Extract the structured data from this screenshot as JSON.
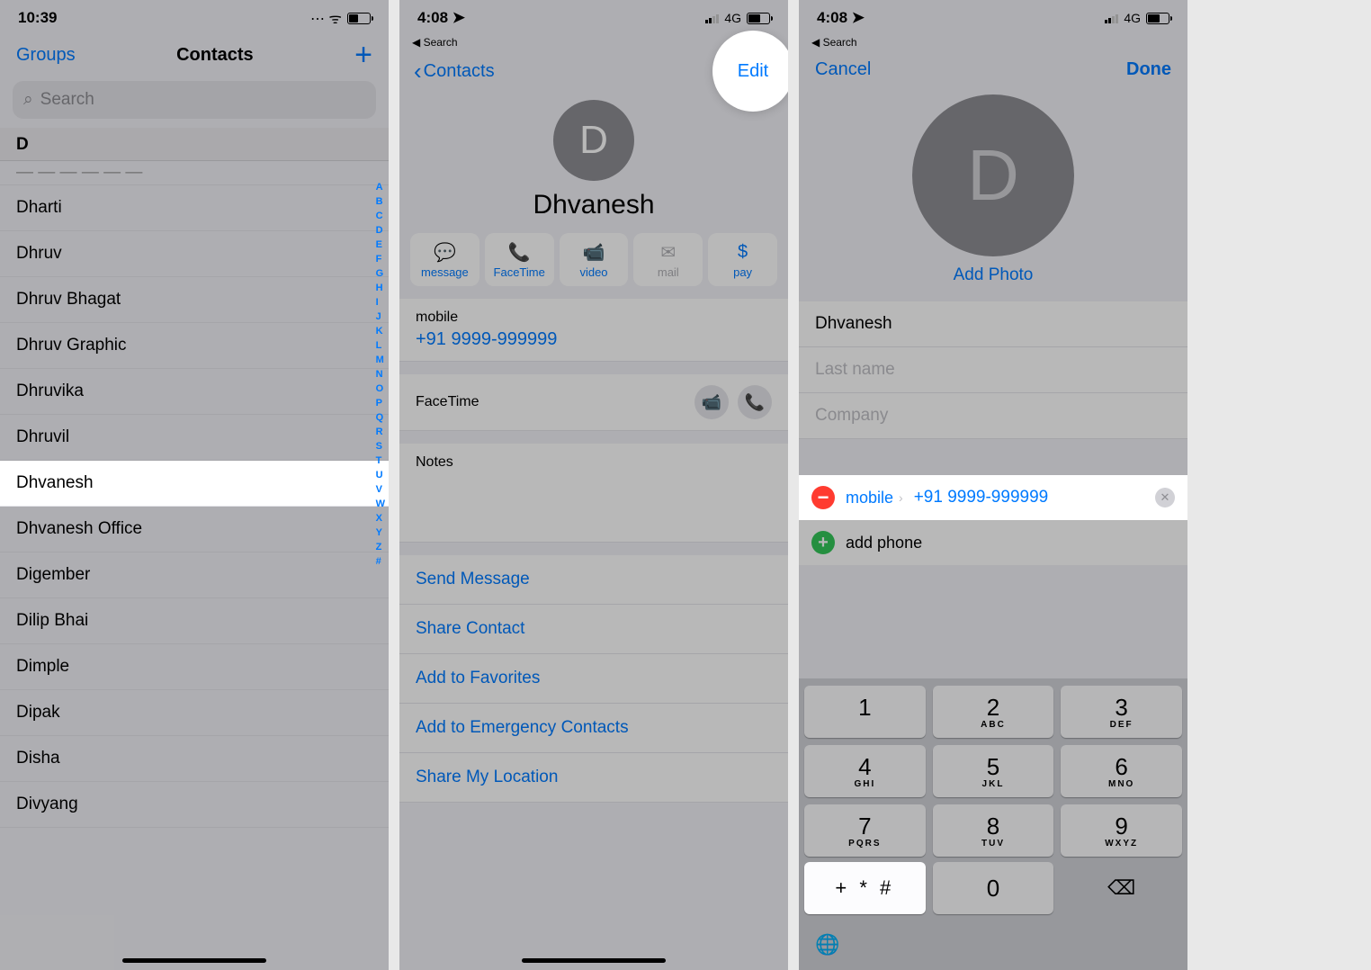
{
  "screen1": {
    "time": "10:39",
    "groups": "Groups",
    "title": "Contacts",
    "search_placeholder": "Search",
    "section": "D",
    "rows": [
      "Dharti",
      "Dhruv",
      "Dhruv Bhagat",
      "Dhruv Graphic",
      "Dhruvika",
      "Dhruvil",
      "Dhvanesh",
      "Dhvanesh Office",
      "Digember",
      "Dilip Bhai",
      "Dimple",
      "Dipak",
      "Disha",
      "Divyang"
    ],
    "highlighted": "Dhvanesh",
    "index": [
      "A",
      "B",
      "C",
      "D",
      "E",
      "F",
      "G",
      "H",
      "I",
      "J",
      "K",
      "L",
      "M",
      "N",
      "O",
      "P",
      "Q",
      "R",
      "S",
      "T",
      "U",
      "V",
      "W",
      "X",
      "Y",
      "Z",
      "#"
    ]
  },
  "screen2": {
    "time": "4:08",
    "network": "4G",
    "back_search": "Search",
    "back": "Contacts",
    "edit": "Edit",
    "avatar_letter": "D",
    "name": "Dhvanesh",
    "actions": {
      "message": "message",
      "facetime": "FaceTime",
      "video": "video",
      "mail": "mail",
      "pay": "pay"
    },
    "mobile_label": "mobile",
    "mobile_value": "+91 9999-999999",
    "facetime_label": "FaceTime",
    "notes_label": "Notes",
    "links": [
      "Send Message",
      "Share Contact",
      "Add to Favorites",
      "Add to Emergency Contacts",
      "Share My Location"
    ]
  },
  "screen3": {
    "time": "4:08",
    "network": "4G",
    "back_search": "Search",
    "cancel": "Cancel",
    "done": "Done",
    "avatar_letter": "D",
    "add_photo": "Add Photo",
    "first_name": "Dhvanesh",
    "last_name_ph": "Last name",
    "company_ph": "Company",
    "mobile_type": "mobile",
    "phone_value": "+91 9999-999999",
    "add_phone": "add phone",
    "keys": [
      {
        "n": "1",
        "s": ""
      },
      {
        "n": "2",
        "s": "ABC"
      },
      {
        "n": "3",
        "s": "DEF"
      },
      {
        "n": "4",
        "s": "GHI"
      },
      {
        "n": "5",
        "s": "JKL"
      },
      {
        "n": "6",
        "s": "MNO"
      },
      {
        "n": "7",
        "s": "PQRS"
      },
      {
        "n": "8",
        "s": "TUV"
      },
      {
        "n": "9",
        "s": "WXYZ"
      }
    ],
    "sym_key": "+ * #",
    "zero": "0"
  }
}
